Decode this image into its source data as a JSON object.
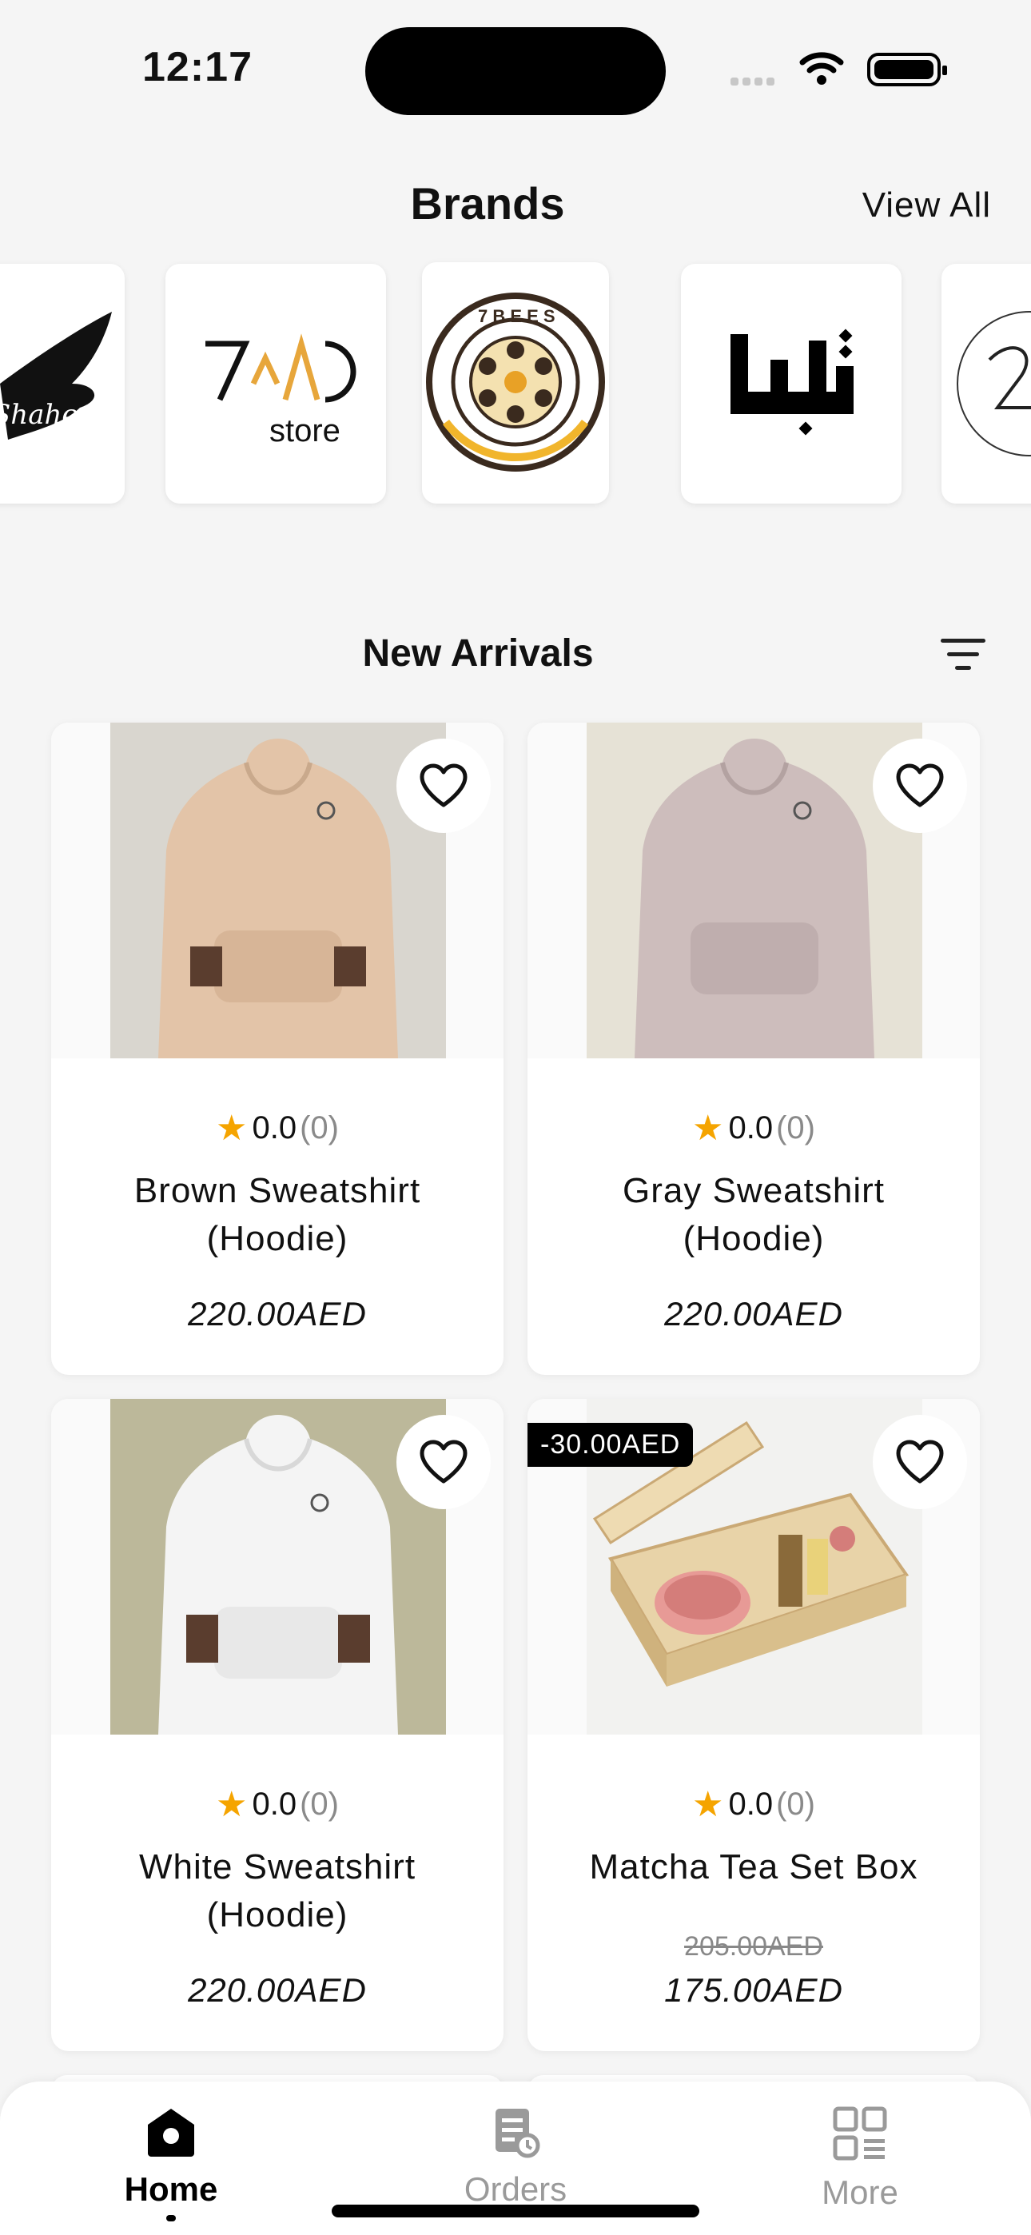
{
  "status_bar": {
    "time": "12:17"
  },
  "brands": {
    "title": "Brands",
    "view_all": "View All",
    "items": [
      {
        "logo": "shaheen-eagle-logo",
        "wordmark": "Shaheen"
      },
      {
        "logo": "7ad-store-logo",
        "wordmark": "7^^D store"
      },
      {
        "logo": "7bees-logo",
        "wordmark": "7BEES"
      },
      {
        "logo": "arabic-calligraphy-logo",
        "wordmark": ""
      },
      {
        "logo": "partial-circle-logo",
        "wordmark": ""
      }
    ]
  },
  "new_arrivals": {
    "title": "New Arrivals",
    "products": [
      {
        "name_line1": "Brown Sweatshirt",
        "name_line2": "(Hoodie)",
        "rating": "0.0",
        "count": "(0)",
        "price": "220.00AED",
        "old_price": "",
        "discount": "",
        "color": "#e3c4a8"
      },
      {
        "name_line1": "Gray Sweatshirt",
        "name_line2": "(Hoodie)",
        "rating": "0.0",
        "count": "(0)",
        "price": "220.00AED",
        "old_price": "",
        "discount": "",
        "color": "#cdbdbc"
      },
      {
        "name_line1": "White Sweatshirt",
        "name_line2": "(Hoodie)",
        "rating": "0.0",
        "count": "(0)",
        "price": "220.00AED",
        "old_price": "",
        "discount": "",
        "color": "#f4f4f4"
      },
      {
        "name_line1": "Matcha Tea Set Box",
        "name_line2": "",
        "rating": "0.0",
        "count": "(0)",
        "price": "175.00AED",
        "old_price": "205.00AED",
        "discount": "-30.00AED",
        "color": "#e8d3a8"
      }
    ]
  },
  "bottom_nav": {
    "items": [
      {
        "label": "Home",
        "icon": "home-icon",
        "active": true
      },
      {
        "label": "Orders",
        "icon": "orders-icon",
        "active": false
      },
      {
        "label": "More",
        "icon": "more-grid-icon",
        "active": false
      }
    ]
  },
  "colors": {
    "star": "#f5a400",
    "active_nav": "#000000",
    "inactive_nav": "#9a9a9a"
  }
}
